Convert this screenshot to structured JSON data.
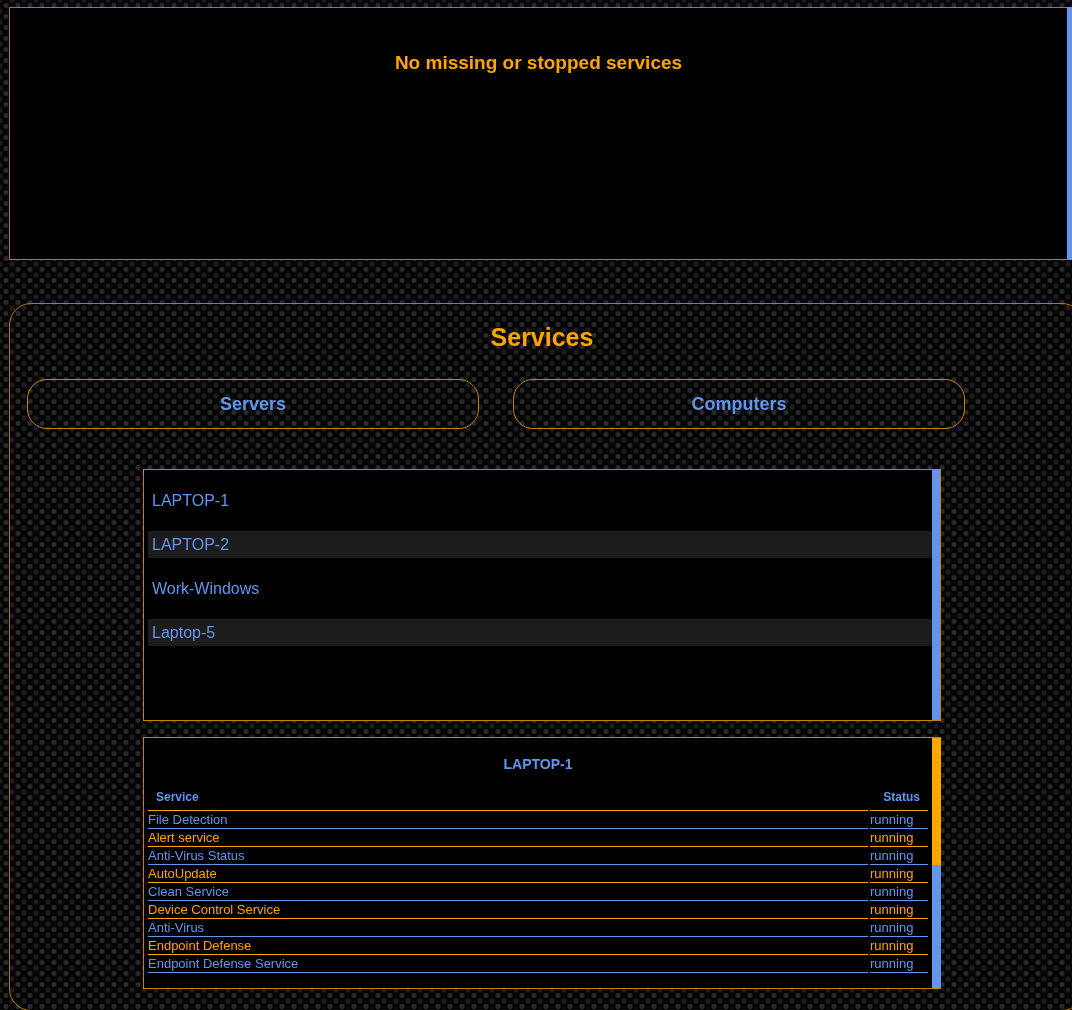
{
  "status_message": "No missing or stopped services",
  "services": {
    "title": "Services",
    "tabs": [
      {
        "label": "Servers"
      },
      {
        "label": "Computers"
      }
    ],
    "computers": [
      {
        "name": "LAPTOP-1"
      },
      {
        "name": "LAPTOP-2"
      },
      {
        "name": "Work-Windows"
      },
      {
        "name": "Laptop-5"
      }
    ],
    "detail": {
      "title": "LAPTOP-1",
      "columns": [
        "Service",
        "Status"
      ],
      "rows": [
        {
          "service": "File Detection",
          "status": "running"
        },
        {
          "service": "Alert service",
          "status": "running"
        },
        {
          "service": "Anti-Virus Status",
          "status": "running"
        },
        {
          "service": "AutoUpdate",
          "status": "running"
        },
        {
          "service": "Clean Service",
          "status": "running"
        },
        {
          "service": "Device Control Service",
          "status": "running"
        },
        {
          "service": "Anti-Virus",
          "status": "running"
        },
        {
          "service": "Endpoint Defense",
          "status": "running"
        },
        {
          "service": "Endpoint Defense Service",
          "status": "running"
        }
      ]
    }
  }
}
